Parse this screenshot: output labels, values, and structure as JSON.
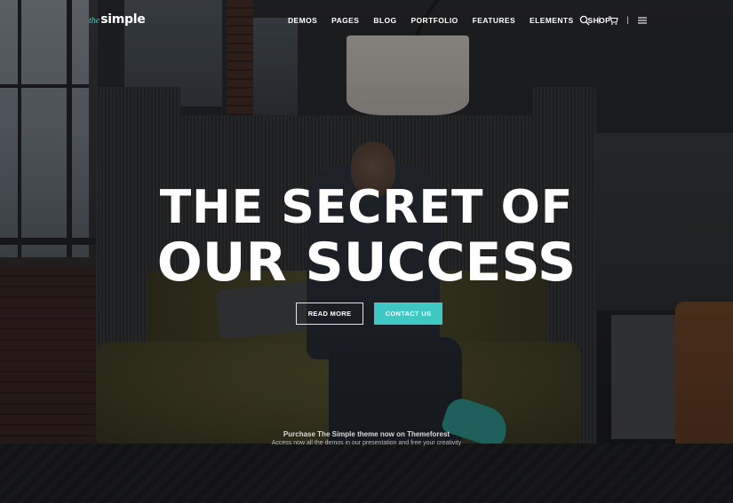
{
  "logo": {
    "prefix": "the",
    "name": "simple"
  },
  "nav": {
    "items": [
      "DEMOS",
      "PAGES",
      "BLOG",
      "PORTFOLIO",
      "FEATURES",
      "ELEMENTS",
      "SHOP"
    ],
    "separator": "|"
  },
  "icons": {
    "search": "search-icon",
    "cart": "cart-icon",
    "menu": "hamburger-menu-icon"
  },
  "hero": {
    "line1": "THE SECRET OF",
    "line2": "OUR SUCCESS",
    "read_more": "READ MORE",
    "contact_us": "CONTACT US"
  },
  "promo": {
    "title": "Purchase The Simple theme now on Themeforest",
    "subtitle": "Access now all the demos in our presentation and free your creativity"
  },
  "colors": {
    "accent": "#3ec7c3",
    "text": "#ffffff"
  }
}
